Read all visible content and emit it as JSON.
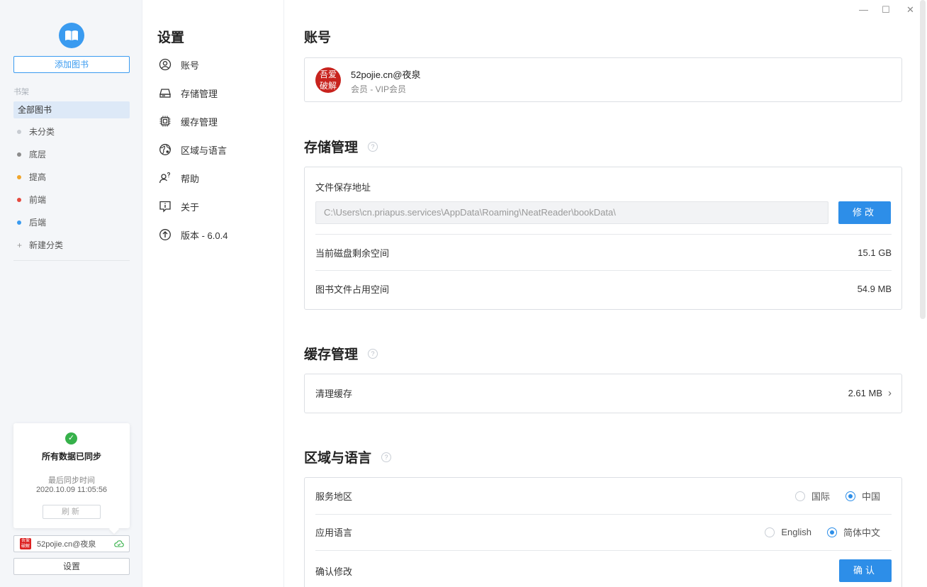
{
  "sidebar": {
    "add_book": "添加图书",
    "shelf_label": "书架",
    "all_books": "全部图书",
    "categories": [
      {
        "label": "未分类",
        "color": "#c8ccd2"
      },
      {
        "label": "底层",
        "color": "#8c8c8c"
      },
      {
        "label": "提高",
        "color": "#f0a52c"
      },
      {
        "label": "前端",
        "color": "#e54a3f"
      },
      {
        "label": "后端",
        "color": "#3a9bf0"
      }
    ],
    "new_category": "新建分类",
    "sync": {
      "title": "所有数据已同步",
      "last_sync_label": "最后同步时间",
      "last_sync_time": "2020.10.09 11:05:56",
      "refresh": "刷新"
    },
    "user_chip": "52pojie.cn@夜泉",
    "settings": "设置"
  },
  "nav": {
    "title": "设置",
    "items": [
      {
        "label": "账号",
        "icon": "account-icon"
      },
      {
        "label": "存储管理",
        "icon": "storage-icon"
      },
      {
        "label": "缓存管理",
        "icon": "cache-icon"
      },
      {
        "label": "区域与语言",
        "icon": "globe-icon"
      },
      {
        "label": "帮助",
        "icon": "help-icon"
      },
      {
        "label": "关于",
        "icon": "about-icon"
      },
      {
        "label": "版本 - 6.0.4",
        "icon": "version-icon"
      }
    ]
  },
  "account": {
    "title": "账号",
    "avatar_text": "吾爱破解",
    "name": "52pojie.cn@夜泉",
    "level": "会员 - VIP会员"
  },
  "storage": {
    "title": "存储管理",
    "path_label": "文件保存地址",
    "path": "C:\\Users\\cn.priapus.services\\AppData\\Roaming\\NeatReader\\bookData\\",
    "modify": "修改",
    "disk_free_label": "当前磁盘剩余空间",
    "disk_free": "15.1 GB",
    "books_size_label": "图书文件占用空间",
    "books_size": "54.9 MB"
  },
  "cache": {
    "title": "缓存管理",
    "clear_label": "清理缓存",
    "size": "2.61 MB"
  },
  "region": {
    "title": "区域与语言",
    "service_label": "服务地区",
    "service_options": [
      "国际",
      "中国"
    ],
    "service_selected": "中国",
    "lang_label": "应用语言",
    "lang_options": [
      "English",
      "简体中文"
    ],
    "lang_selected": "简体中文",
    "confirm_label": "确认修改",
    "confirm_button": "确认"
  },
  "colors": {
    "accent": "#2d8ee8",
    "sidebar_bg": "#f4f6f9",
    "sync_ok": "#36b14a"
  }
}
